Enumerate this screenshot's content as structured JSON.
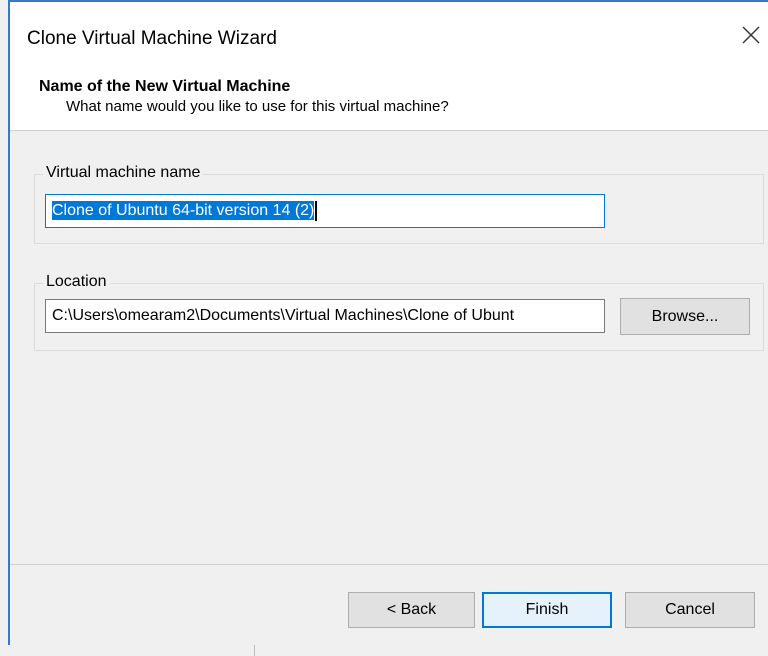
{
  "window": {
    "title": "Clone Virtual Machine Wizard",
    "close_icon": "close-icon"
  },
  "header": {
    "title": "Name of the New Virtual Machine",
    "subtitle": "What name would you like to use for this virtual machine?"
  },
  "vm_name": {
    "label": "Virtual machine name",
    "value": "Clone of Ubuntu 64-bit version 14 (2)"
  },
  "location": {
    "label": "Location",
    "value": "C:\\Users\\omearam2\\Documents\\Virtual Machines\\Clone of Ubunt",
    "browse_label": "Browse..."
  },
  "buttons": {
    "back_label": "< Back",
    "finish_label": "Finish",
    "cancel_label": "Cancel"
  },
  "colors": {
    "accent": "#0078d7",
    "window_border": "#3a78c7"
  }
}
